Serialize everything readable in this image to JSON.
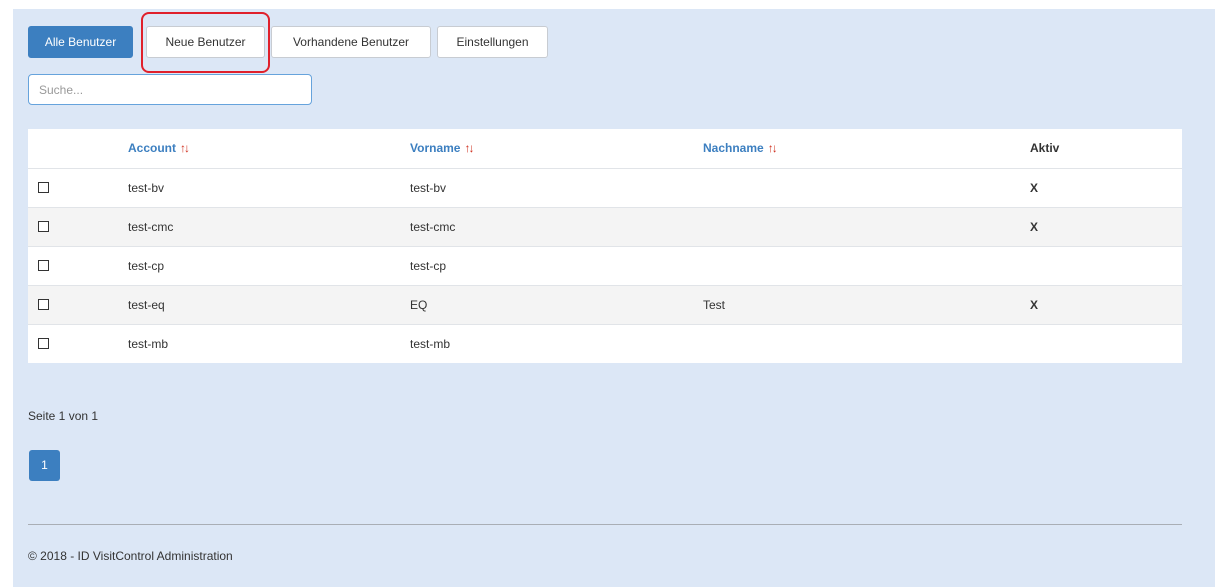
{
  "tabs": [
    {
      "label": "Alle Benutzer",
      "active": true
    },
    {
      "label": "Neue Benutzer",
      "active": false
    },
    {
      "label": "Vorhandene Benutzer",
      "active": false
    },
    {
      "label": "Einstellungen",
      "active": false
    }
  ],
  "search": {
    "placeholder": "Suche...",
    "value": ""
  },
  "table": {
    "headers": {
      "account": "Account",
      "vorname": "Vorname",
      "nachname": "Nachname",
      "aktiv": "Aktiv"
    },
    "sort_glyph": "↑↓",
    "rows": [
      {
        "account": "test-bv",
        "vorname": "test-bv",
        "nachname": "",
        "aktiv": "X"
      },
      {
        "account": "test-cmc",
        "vorname": "test-cmc",
        "nachname": "",
        "aktiv": "X"
      },
      {
        "account": "test-cp",
        "vorname": "test-cp",
        "nachname": "",
        "aktiv": ""
      },
      {
        "account": "test-eq",
        "vorname": "EQ",
        "nachname": "Test",
        "aktiv": "X"
      },
      {
        "account": "test-mb",
        "vorname": "test-mb",
        "nachname": "",
        "aktiv": ""
      }
    ]
  },
  "pagination": {
    "info": "Seite 1 von 1",
    "current_page": "1"
  },
  "footer": {
    "text": "© 2018 - ID VisitControl Administration"
  },
  "colors": {
    "accent": "#3c7fc0",
    "background": "#dce7f6",
    "highlight": "#e0202b",
    "sort_icon": "#d0301f"
  }
}
